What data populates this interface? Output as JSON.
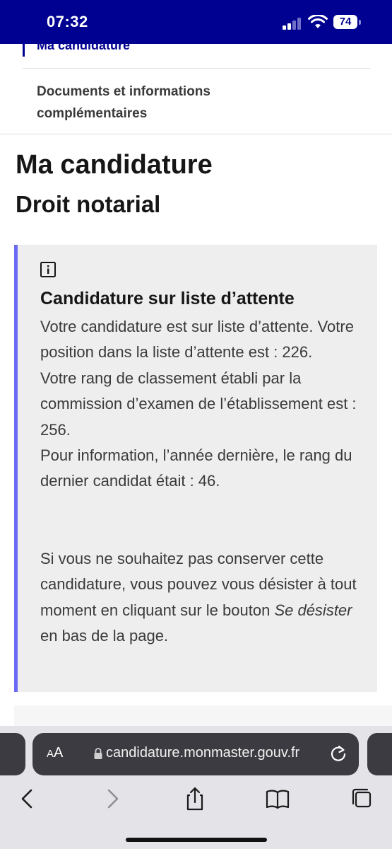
{
  "status_bar": {
    "time": "07:32",
    "battery": "74",
    "background_color": "#000091"
  },
  "side_menu": {
    "active_item": "Ma candidature",
    "items": [
      "Documents et informations complémentaires"
    ]
  },
  "page": {
    "title": "Ma candidature",
    "subtitle": "Droit notarial"
  },
  "callout": {
    "icon": "info-icon",
    "accent_color": "#6a6af4",
    "title": "Candidature sur liste d’attente",
    "paragraph_1": "Votre candidature est sur liste d’attente. Votre position dans la liste d’attente est : 226.",
    "paragraph_2": "Votre rang de classement établi par la commission d’examen de l’établissement est : 256.",
    "paragraph_3": "Pour information, l’année dernière, le rang du dernier candidat était : 46.",
    "paragraph_4_before": "Si vous ne souhaitez pas conserver cette candidature, vous pouvez vous désister à tout moment en cliquant sur le bouton",
    "paragraph_4_button": "Se désister",
    "paragraph_4_after": "en bas de la page."
  },
  "browser": {
    "aa_big": "A",
    "aa_small": "A",
    "url": "candidature.monmaster.gouv.fr",
    "toolbar": [
      "back-icon",
      "forward-icon",
      "share-icon",
      "bookmarks-icon",
      "tabs-icon"
    ]
  }
}
